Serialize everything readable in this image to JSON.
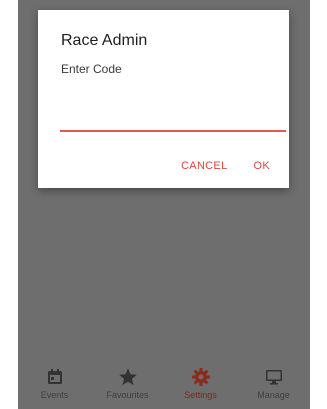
{
  "dialog": {
    "title": "Race Admin",
    "message": "Enter Code",
    "input_value": "",
    "cancel_label": "CANCEL",
    "ok_label": "OK"
  },
  "bottom_nav": {
    "items": [
      {
        "label": "Events",
        "icon": "calendar-icon",
        "active": false
      },
      {
        "label": "Favourites",
        "icon": "star-icon",
        "active": false
      },
      {
        "label": "Settings",
        "icon": "gear-icon",
        "active": true
      },
      {
        "label": "Manage",
        "icon": "monitor-icon",
        "active": false
      }
    ]
  },
  "colors": {
    "accent": "#d9483b",
    "scrim": "#6e6e6e",
    "active_nav": "#7a2a20",
    "inactive_nav": "#3e3e3e"
  }
}
